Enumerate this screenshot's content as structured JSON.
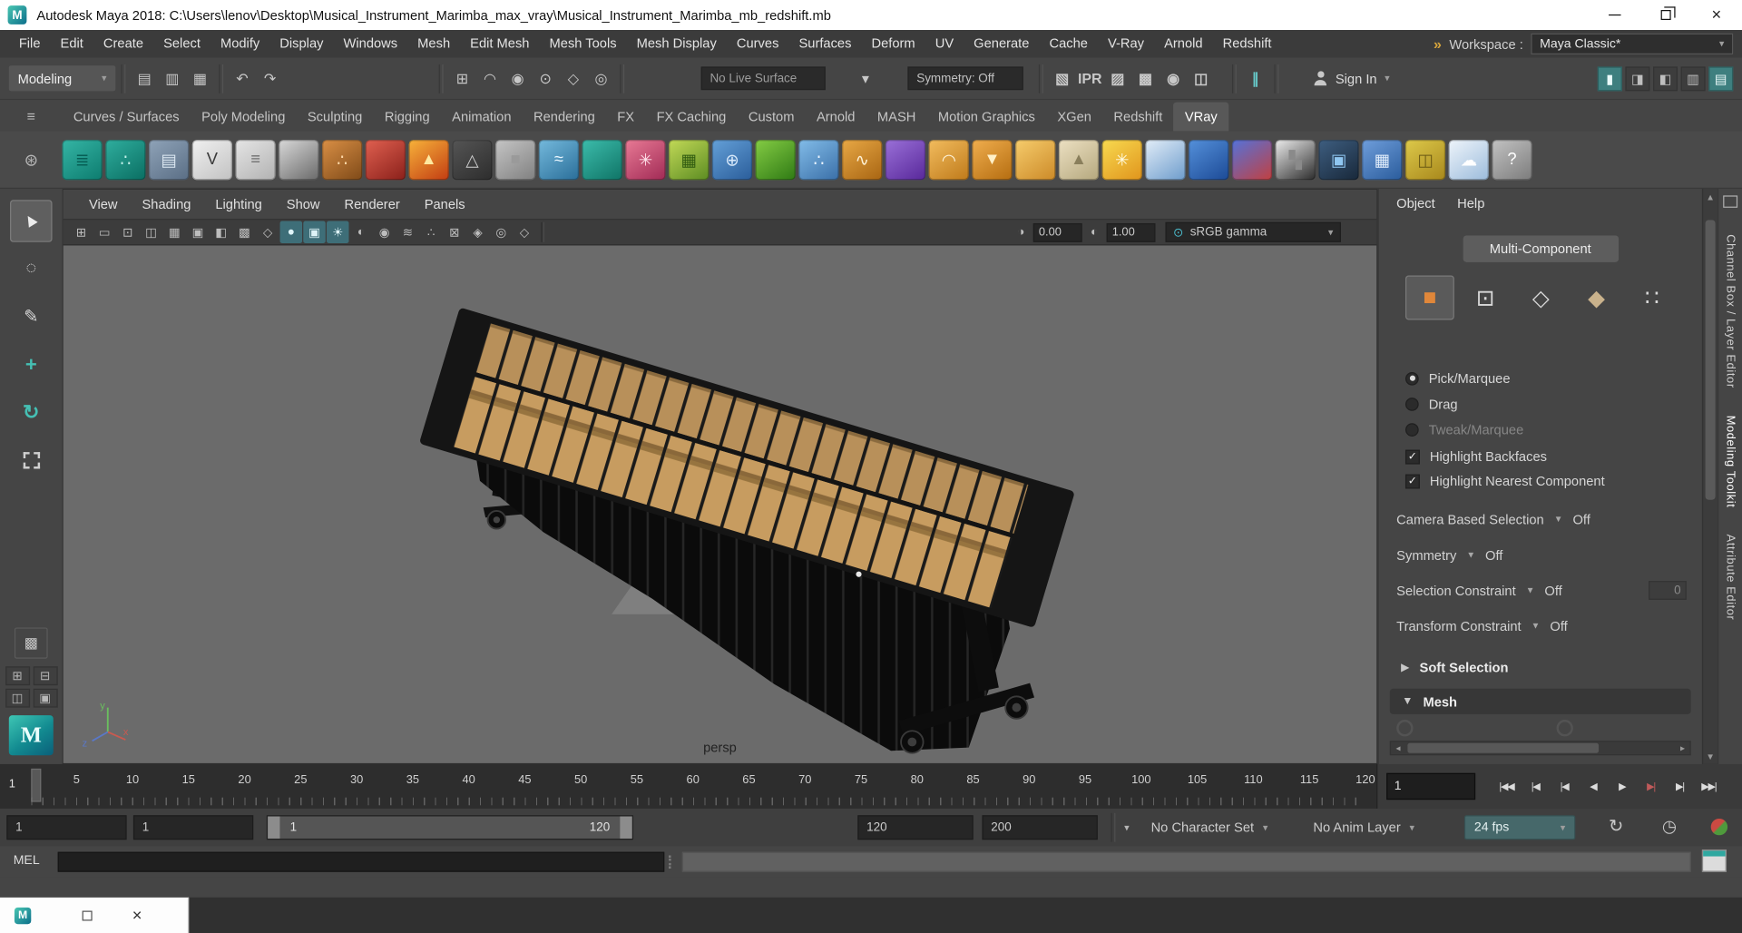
{
  "colors": {
    "accent_teal": "#3fb5aa",
    "viewport_bg": "#6b6b6b",
    "panel_bg": "#454545",
    "bar_wood": "#c79c60",
    "workspace_chevron_gold": "#d7a53c"
  },
  "titlebar": {
    "title": "Autodesk Maya 2018: C:\\Users\\lenov\\Desktop\\Musical_Instrument_Marimba_max_vray\\Musical_Instrument_Marimba_mb_redshift.mb"
  },
  "menubar": {
    "items": [
      "File",
      "Edit",
      "Create",
      "Select",
      "Modify",
      "Display",
      "Windows",
      "Mesh",
      "Edit Mesh",
      "Mesh Tools",
      "Mesh Display",
      "Curves",
      "Surfaces",
      "Deform",
      "UV",
      "Generate",
      "Cache",
      "V-Ray",
      "Arnold",
      "Redshift"
    ],
    "workspace_chevrons": "»",
    "workspace_label": "Workspace :",
    "workspace_value": "Maya Classic*"
  },
  "statusline": {
    "mode": "Modeling",
    "file_icons": [
      {
        "name": "new-scene-icon",
        "g": "▤"
      },
      {
        "name": "open-scene-icon",
        "g": "▥"
      },
      {
        "name": "save-scene-icon",
        "g": "▦"
      }
    ],
    "history_icons": [
      {
        "name": "undo-icon",
        "g": "↶"
      },
      {
        "name": "redo-icon",
        "g": "↷"
      }
    ],
    "snap_icons": [
      {
        "name": "snap-to-grid-icon",
        "g": "⊞"
      },
      {
        "name": "snap-to-curve-icon",
        "g": "◠"
      },
      {
        "name": "snap-to-point-icon",
        "g": "◉"
      },
      {
        "name": "snap-to-projected-center-icon",
        "g": "⊙"
      },
      {
        "name": "snap-to-view-plane-icon",
        "g": "◇"
      },
      {
        "name": "make-live-icon",
        "g": "◎"
      }
    ],
    "live_surface": "No Live Surface",
    "symmetry": "Symmetry: Off",
    "render_icons": [
      {
        "name": "render-frame-icon",
        "g": "▧"
      },
      {
        "name": "ipr-render-icon",
        "g": "IPR"
      },
      {
        "name": "render-sequence-icon",
        "g": "▨"
      },
      {
        "name": "render-settings-icon",
        "g": "▩"
      },
      {
        "name": "hypershade-icon",
        "g": "◉"
      },
      {
        "name": "light-editor-icon",
        "g": "◫"
      }
    ],
    "pause_glyph": "∥",
    "signin_label": "Sign In",
    "panel_toggles": [
      {
        "name": "modeling-toolkit-toggle-icon",
        "g": "▮",
        "active": true
      },
      {
        "name": "attribute-editor-toggle-icon",
        "g": "◨"
      },
      {
        "name": "tool-settings-toggle-icon",
        "g": "◧"
      },
      {
        "name": "channel-box-toggle-icon",
        "g": "▥"
      },
      {
        "name": "outliner-toggle-icon",
        "g": "▤",
        "active": true
      }
    ]
  },
  "shelf": {
    "tabs": [
      {
        "label": "Curves / Surfaces"
      },
      {
        "label": "Poly Modeling"
      },
      {
        "label": "Sculpting"
      },
      {
        "label": "Rigging"
      },
      {
        "label": "Animation"
      },
      {
        "label": "Rendering"
      },
      {
        "label": "FX"
      },
      {
        "label": "FX Caching"
      },
      {
        "label": "Custom"
      },
      {
        "label": "Arnold"
      },
      {
        "label": "MASH"
      },
      {
        "label": "Motion Graphics"
      },
      {
        "label": "XGen"
      },
      {
        "label": "Redshift"
      },
      {
        "label": "VRay",
        "active": true
      }
    ],
    "icons": [
      {
        "name": "vray-geometry-icon",
        "c1": "#35b5a5",
        "c2": "#0d7c6f",
        "g": "≣",
        "gc": "#065f55"
      },
      {
        "name": "vray-plane-icon",
        "c1": "#2fae9e",
        "c2": "#0a6e62",
        "g": "∴",
        "gc": "#bff0e8"
      },
      {
        "name": "vray-proxy-icon",
        "c1": "#8fa3b8",
        "c2": "#5a6e85",
        "g": "▤",
        "gc": "#dce8f2"
      },
      {
        "name": "vray-logo-icon",
        "c1": "#f0f0f0",
        "c2": "#c2c2c2",
        "g": "V",
        "gc": "#3a3a3a"
      },
      {
        "name": "notes-icon",
        "c1": "#e5e5e5",
        "c2": "#b2b2b2",
        "g": "≡",
        "gc": "#707070"
      },
      {
        "name": "sphere-gray-icon",
        "c1": "#d8d8d8",
        "c2": "#6a6a6a",
        "g": ""
      },
      {
        "name": "spheres-orange-icon",
        "c1": "#d98f45",
        "c2": "#7f4a18",
        "g": "∴",
        "gc": "#ffd9a8"
      },
      {
        "name": "sphere-red-icon",
        "c1": "#e06050",
        "c2": "#8a201a",
        "g": ""
      },
      {
        "name": "fire-icon",
        "c1": "#f7b23a",
        "c2": "#c23c12",
        "g": "▲",
        "gc": "#ffe9a0"
      },
      {
        "name": "pyramid-wire-icon",
        "c1": "#555555",
        "c2": "#2d2d2d",
        "g": "△",
        "gc": "#cfcfcf"
      },
      {
        "name": "cube-icon",
        "c1": "#c5c5c5",
        "c2": "#808080",
        "g": "■",
        "gc": "#9a9a9a"
      },
      {
        "name": "liquid-plane-icon",
        "c1": "#74b9dc",
        "c2": "#2a6e99",
        "g": "≈",
        "gc": "#e8f6ff"
      },
      {
        "name": "droplet-icon",
        "c1": "#3cbcab",
        "c2": "#0f7466",
        "g": ""
      },
      {
        "name": "fx-star-icon",
        "c1": "#e87a95",
        "c2": "#a12a55",
        "g": "✳",
        "gc": "#ffe2ea"
      },
      {
        "name": "checker-plane-icon",
        "c1": "#c2d957",
        "c2": "#5c8c22",
        "g": "▦",
        "gc": "#2f5a10"
      },
      {
        "name": "globe-icon",
        "c1": "#64a0d8",
        "c2": "#2a5d9a",
        "g": "⊕",
        "gc": "#d7e8fa"
      },
      {
        "name": "grass-icon",
        "c1": "#84cc44",
        "c2": "#2f7a14",
        "g": ""
      },
      {
        "name": "particles-icon",
        "c1": "#82bce8",
        "c2": "#3a6fa8",
        "g": "∴",
        "gc": "#eaf4ff"
      },
      {
        "name": "curve-tool-icon",
        "c1": "#e8a845",
        "c2": "#a86512",
        "g": "∿",
        "gc": "#fff2d5"
      },
      {
        "name": "sphere-purple-icon",
        "c1": "#9a70d8",
        "c2": "#58289a",
        "g": ""
      },
      {
        "name": "dome-light-icon",
        "c1": "#f2bc5e",
        "c2": "#bf7a1a",
        "g": "◠",
        "gc": "#fff4da"
      },
      {
        "name": "spot-light-icon",
        "c1": "#f0ae4e",
        "c2": "#b56d10",
        "g": "▼",
        "gc": "#fff0c8"
      },
      {
        "name": "sphere-light-icon",
        "c1": "#f6cc6c",
        "c2": "#cc8a28",
        "g": ""
      },
      {
        "name": "ies-light-icon",
        "c1": "#ece0c2",
        "c2": "#b5a87e",
        "g": "▲",
        "gc": "#8a7f5c"
      },
      {
        "name": "sun-light-icon",
        "c1": "#f8da50",
        "c2": "#e0941c",
        "g": "✳",
        "gc": "#fffbe0"
      },
      {
        "name": "sky-icon",
        "c1": "#e2edf8",
        "c2": "#6d9ccc",
        "g": ""
      },
      {
        "name": "sphere-blue-icon",
        "c1": "#5490da",
        "c2": "#1c4a96",
        "g": ""
      },
      {
        "name": "sphere-dual-icon",
        "c1": "#5472da",
        "c2": "#c24040",
        "g": ""
      },
      {
        "name": "checker-bw-icon",
        "c1": "#ececec",
        "c2": "#2c2c2c",
        "g": "▚",
        "gc": "#8a8a8a"
      },
      {
        "name": "render-view-icon",
        "c1": "#3e5e80",
        "c2": "#18283a",
        "g": "▣",
        "gc": "#8fc6f0"
      },
      {
        "name": "spreadsheet-icon",
        "c1": "#6f9edb",
        "c2": "#2a5c9c",
        "g": "▦",
        "gc": "#e2eefb"
      },
      {
        "name": "bake-icon",
        "c1": "#ddc94a",
        "c2": "#a8881c",
        "g": "◫",
        "gc": "#6b5a14"
      },
      {
        "name": "cloud-icon",
        "c1": "#eef4fa",
        "c2": "#9cbcdc",
        "g": "☁",
        "gc": "#ffffff"
      },
      {
        "name": "help-icon",
        "c1": "#c2c2c2",
        "c2": "#7c7c7c",
        "g": "?",
        "gc": "#ffffff"
      }
    ]
  },
  "toolbox": {
    "tools": [
      {
        "name": "select-tool",
        "g": "▲",
        "cls": "cursor",
        "active": true
      },
      {
        "name": "lasso-tool",
        "g": "◌"
      },
      {
        "name": "paint-select-tool",
        "g": "✎"
      },
      {
        "name": "move-tool",
        "g": "+",
        "cls": "teal"
      },
      {
        "name": "rotate-tool",
        "g": "↻",
        "cls": "teal"
      },
      {
        "name": "scale-tool",
        "g": "",
        "cls": "dashed"
      }
    ],
    "isolate_glyph": "▩",
    "layout_icons": [
      {
        "name": "single-pane-layout-icon",
        "g": "⊞"
      },
      {
        "name": "four-pane-layout-icon",
        "g": "⊟"
      },
      {
        "name": "two-pane-layout-icon",
        "g": "◫"
      },
      {
        "name": "three-pane-layout-icon",
        "g": "▣"
      }
    ],
    "logo_letter": "M"
  },
  "viewport": {
    "menus": [
      "View",
      "Shading",
      "Lighting",
      "Show",
      "Renderer",
      "Panels"
    ],
    "icons": [
      {
        "name": "grid-toggle-icon",
        "g": "⊞"
      },
      {
        "name": "film-gate-icon",
        "g": "▭"
      },
      {
        "name": "resolution-gate-icon",
        "g": "⊡"
      },
      {
        "name": "gate-mask-icon",
        "g": "◫"
      },
      {
        "name": "field-chart-icon",
        "g": "▦"
      },
      {
        "name": "safe-action-icon",
        "g": "▣"
      },
      {
        "name": "safe-title-icon",
        "g": "◧"
      },
      {
        "name": "fill-mode-icon",
        "g": "▩"
      },
      {
        "name": "wireframe-mode-icon",
        "g": "◇"
      },
      {
        "name": "shaded-mode-icon",
        "g": "●",
        "active": true
      },
      {
        "name": "textured-mode-icon",
        "g": "▣",
        "active": true
      },
      {
        "name": "use-all-lights-icon",
        "g": "☀",
        "active": true
      },
      {
        "name": "shadows-icon",
        "g": "◐"
      },
      {
        "name": "ambient-occlusion-icon",
        "g": "◉"
      },
      {
        "name": "motion-blur-icon",
        "g": "≋"
      },
      {
        "name": "multisample-icon",
        "g": "∴"
      },
      {
        "name": "xray-icon",
        "g": "⊠"
      },
      {
        "name": "wireframe-on-shaded-icon",
        "g": "◈"
      },
      {
        "name": "default-material-icon",
        "g": "◎"
      },
      {
        "name": "isolate-select-icon",
        "g": "◇"
      }
    ],
    "exposure": "0.00",
    "contrast": "1.00",
    "colorspace": "sRGB gamma",
    "camera_label": "persp",
    "axis_labels": {
      "x": "x",
      "y": "y",
      "z": "z"
    }
  },
  "toolkit": {
    "menus": [
      "Object",
      "Help"
    ],
    "multi_component": "Multi-Component",
    "modes": [
      {
        "name": "object-mode-icon",
        "g": "■",
        "gc": "#e0873a",
        "active": true
      },
      {
        "name": "vertex-mode-icon",
        "g": "⊡",
        "gc": "#d8d8d8"
      },
      {
        "name": "edge-mode-icon",
        "g": "◇",
        "gc": "#d8d8d8"
      },
      {
        "name": "face-mode-icon",
        "g": "◆",
        "gc": "#c9b28c"
      },
      {
        "name": "uv-mode-icon",
        "g": "∷",
        "gc": "#d8d8d8"
      }
    ],
    "radios": [
      {
        "name": "radio-pick-marquee",
        "label": "Pick/Marquee",
        "selected": true
      },
      {
        "name": "radio-drag",
        "label": "Drag"
      },
      {
        "name": "radio-tweak-marquee",
        "label": "Tweak/Marquee",
        "disabled": true
      }
    ],
    "checks": [
      {
        "name": "check-highlight-backfaces",
        "label": "Highlight Backfaces",
        "checked": true
      },
      {
        "name": "check-highlight-nearest-component",
        "label": "Highlight Nearest Component",
        "checked": true
      }
    ],
    "selects": [
      {
        "label": "Camera Based Selection",
        "value": "Off"
      },
      {
        "label": "Symmetry",
        "value": "Off"
      },
      {
        "label": "Selection Constraint",
        "value": "Off",
        "extra": "0"
      },
      {
        "label": "Transform Constraint",
        "value": "Off"
      }
    ],
    "soft_selection": "Soft Selection",
    "mesh_section": "Mesh"
  },
  "side_tabs": {
    "items": [
      {
        "name": "sidetab-channel-box-layer-editor",
        "label": "Channel Box / Layer Editor"
      },
      {
        "name": "sidetab-modeling-toolkit",
        "label": "Modeling Toolkit",
        "active": true
      },
      {
        "name": "sidetab-attribute-editor",
        "label": "Attribute Editor"
      }
    ]
  },
  "timeline": {
    "start_frame": "1",
    "current_frame": "1",
    "labels": [
      {
        "t": "5",
        "left": "3.4%"
      },
      {
        "t": "10",
        "left": "7.6%"
      },
      {
        "t": "15",
        "left": "11.8%"
      },
      {
        "t": "20",
        "left": "16%"
      },
      {
        "t": "25",
        "left": "20.2%"
      },
      {
        "t": "30",
        "left": "24.4%"
      },
      {
        "t": "35",
        "left": "28.6%"
      },
      {
        "t": "40",
        "left": "32.8%"
      },
      {
        "t": "45",
        "left": "37%"
      },
      {
        "t": "50",
        "left": "41.2%"
      },
      {
        "t": "55",
        "left": "45.4%"
      },
      {
        "t": "60",
        "left": "49.6%"
      },
      {
        "t": "65",
        "left": "53.8%"
      },
      {
        "t": "70",
        "left": "58%"
      },
      {
        "t": "75",
        "left": "62.2%"
      },
      {
        "t": "80",
        "left": "66.4%"
      },
      {
        "t": "85",
        "left": "70.6%"
      },
      {
        "t": "90",
        "left": "74.8%"
      },
      {
        "t": "95",
        "left": "79%"
      },
      {
        "t": "100",
        "left": "83.2%"
      },
      {
        "t": "105",
        "left": "87.4%"
      },
      {
        "t": "110",
        "left": "91.6%"
      },
      {
        "t": "115",
        "left": "95.8%"
      },
      {
        "t": "120",
        "left": "100%"
      }
    ],
    "transport": [
      {
        "name": "go-to-start-button",
        "g": "|◀◀"
      },
      {
        "name": "step-back-frame-button",
        "g": "|◀"
      },
      {
        "name": "step-back-key-button",
        "g": "|◀",
        "color": "#c express05a5a"
      },
      {
        "name": "play-backwards-button",
        "g": "◀"
      },
      {
        "name": "play-forward-button",
        "g": "▶"
      },
      {
        "name": "step-forward-key-button",
        "g": "▶|",
        "color": "#c05a5a"
      },
      {
        "name": "step-forward-frame-button",
        "g": "▶|"
      },
      {
        "name": "go-to-end-button",
        "g": "▶▶|"
      }
    ]
  },
  "range": {
    "anim_start": "1",
    "play_start": "1",
    "range_start": "1",
    "range_end": "120",
    "play_end": "120",
    "anim_end": "200",
    "character_set": "No Character Set",
    "anim_layer": "No Anim Layer",
    "fps": "24 fps"
  },
  "command_line": {
    "label": "MEL",
    "input_value": "",
    "result_value": ""
  }
}
